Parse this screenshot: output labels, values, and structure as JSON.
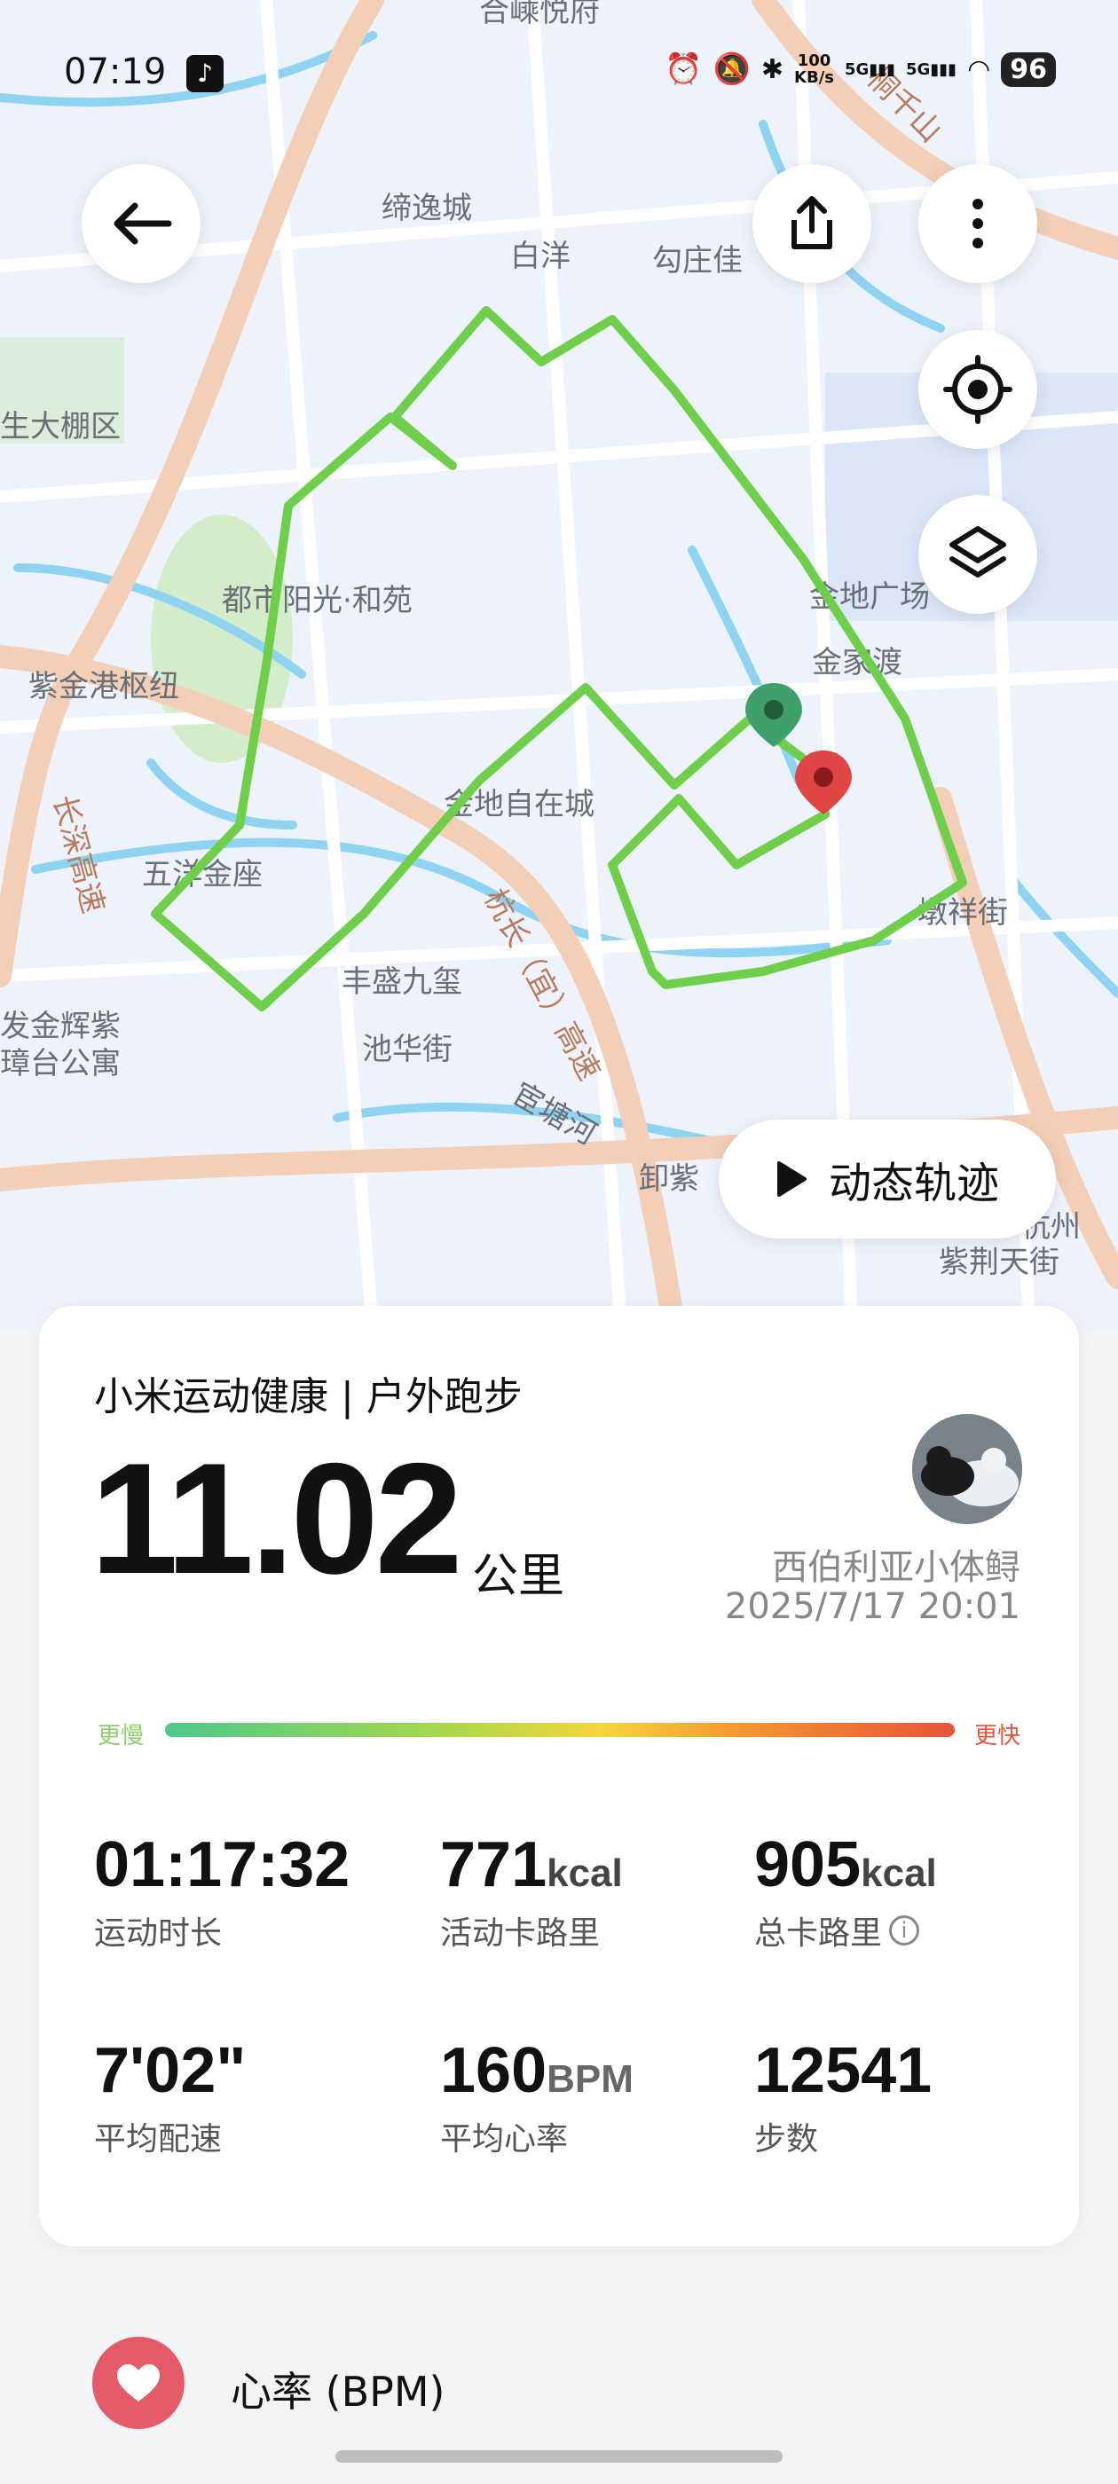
{
  "status_bar": {
    "time": "07:19",
    "net_speed_top": "100",
    "net_speed_bottom": "KB/s",
    "sim1": "5G",
    "sim2": "5G",
    "battery": "96"
  },
  "map": {
    "labels": [
      "合嵊悦府",
      "缔逸城",
      "白洋",
      "勾庄佳",
      "生大棚区",
      "都市阳光·和苑",
      "金地广场",
      "金家渡",
      "紫金港枢纽",
      "金地自在城",
      "五洋金座",
      "长深高速",
      "杭长（宜）高速",
      "墩祥街",
      "丰盛九玺",
      "池华街",
      "发金辉紫",
      "璋台公寓",
      "宦塘河",
      "卸紫",
      "紫荆天街",
      "杭州",
      "桐千山"
    ],
    "track_color": "#6fcf4a",
    "start_pin_color": "#3fa06b",
    "end_pin_color": "#e04545"
  },
  "buttons": {
    "back_icon": "arrow-left-icon",
    "share_icon": "share-icon",
    "more_icon": "more-vertical-icon",
    "locate_icon": "locate-icon",
    "layers_icon": "layers-icon",
    "replay_label": "动态轨迹"
  },
  "summary": {
    "app_title": "小米运动健康 | 户外跑步",
    "distance": "11.02",
    "distance_unit": "公里",
    "user_name": "西伯利亚小体鲟",
    "datetime": "2025/7/17 20:01",
    "pace_slow_label": "更慢",
    "pace_fast_label": "更快"
  },
  "stats": [
    {
      "value": "01:17:32",
      "unit": "",
      "label": "运动时长"
    },
    {
      "value": "771",
      "unit": "kcal",
      "label": "活动卡路里"
    },
    {
      "value": "905",
      "unit": "kcal",
      "label": "总卡路里"
    },
    {
      "value": "7'02\"",
      "unit": "",
      "label": "平均配速"
    },
    {
      "value": "160",
      "unit": "BPM",
      "label": "平均心率"
    },
    {
      "value": "12541",
      "unit": "",
      "label": "步数"
    }
  ],
  "heart_rate": {
    "label": "心率 (BPM)",
    "accent": "#e45a68"
  }
}
